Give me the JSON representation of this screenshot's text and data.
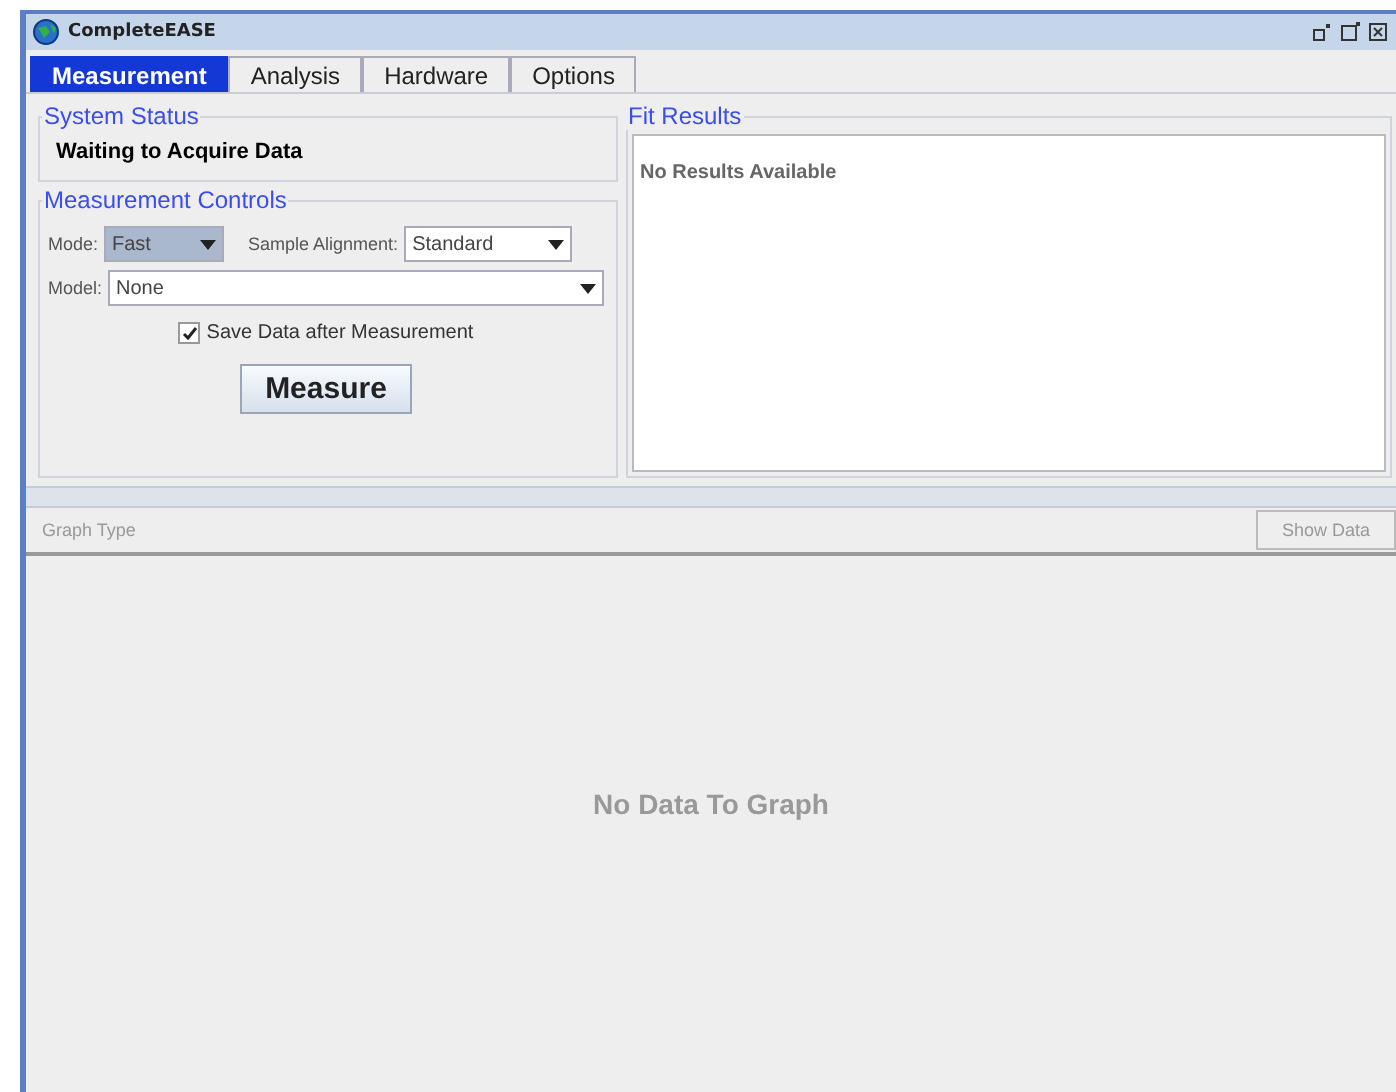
{
  "window": {
    "title": "CompleteEASE"
  },
  "tabs": [
    {
      "label": "Measurement",
      "selected": true
    },
    {
      "label": "Analysis",
      "selected": false
    },
    {
      "label": "Hardware",
      "selected": false
    },
    {
      "label": "Options",
      "selected": false
    }
  ],
  "system_status": {
    "title": "System Status",
    "message": "Waiting to Acquire Data"
  },
  "measurement_controls": {
    "title": "Measurement Controls",
    "mode": {
      "label": "Mode:",
      "value": "Fast",
      "disabled": true
    },
    "sample_alignment": {
      "label": "Sample Alignment:",
      "value": "Standard",
      "disabled": false
    },
    "model": {
      "label": "Model:",
      "value": "None",
      "disabled": false
    },
    "save_data": {
      "label": "Save Data after Measurement",
      "checked": true
    },
    "measure_button": "Measure"
  },
  "fit_results": {
    "title": "Fit Results",
    "message": "No Results Available"
  },
  "graph": {
    "type_label": "Graph Type",
    "show_data_button": "Show Data",
    "empty_message": "No Data To Graph"
  }
}
